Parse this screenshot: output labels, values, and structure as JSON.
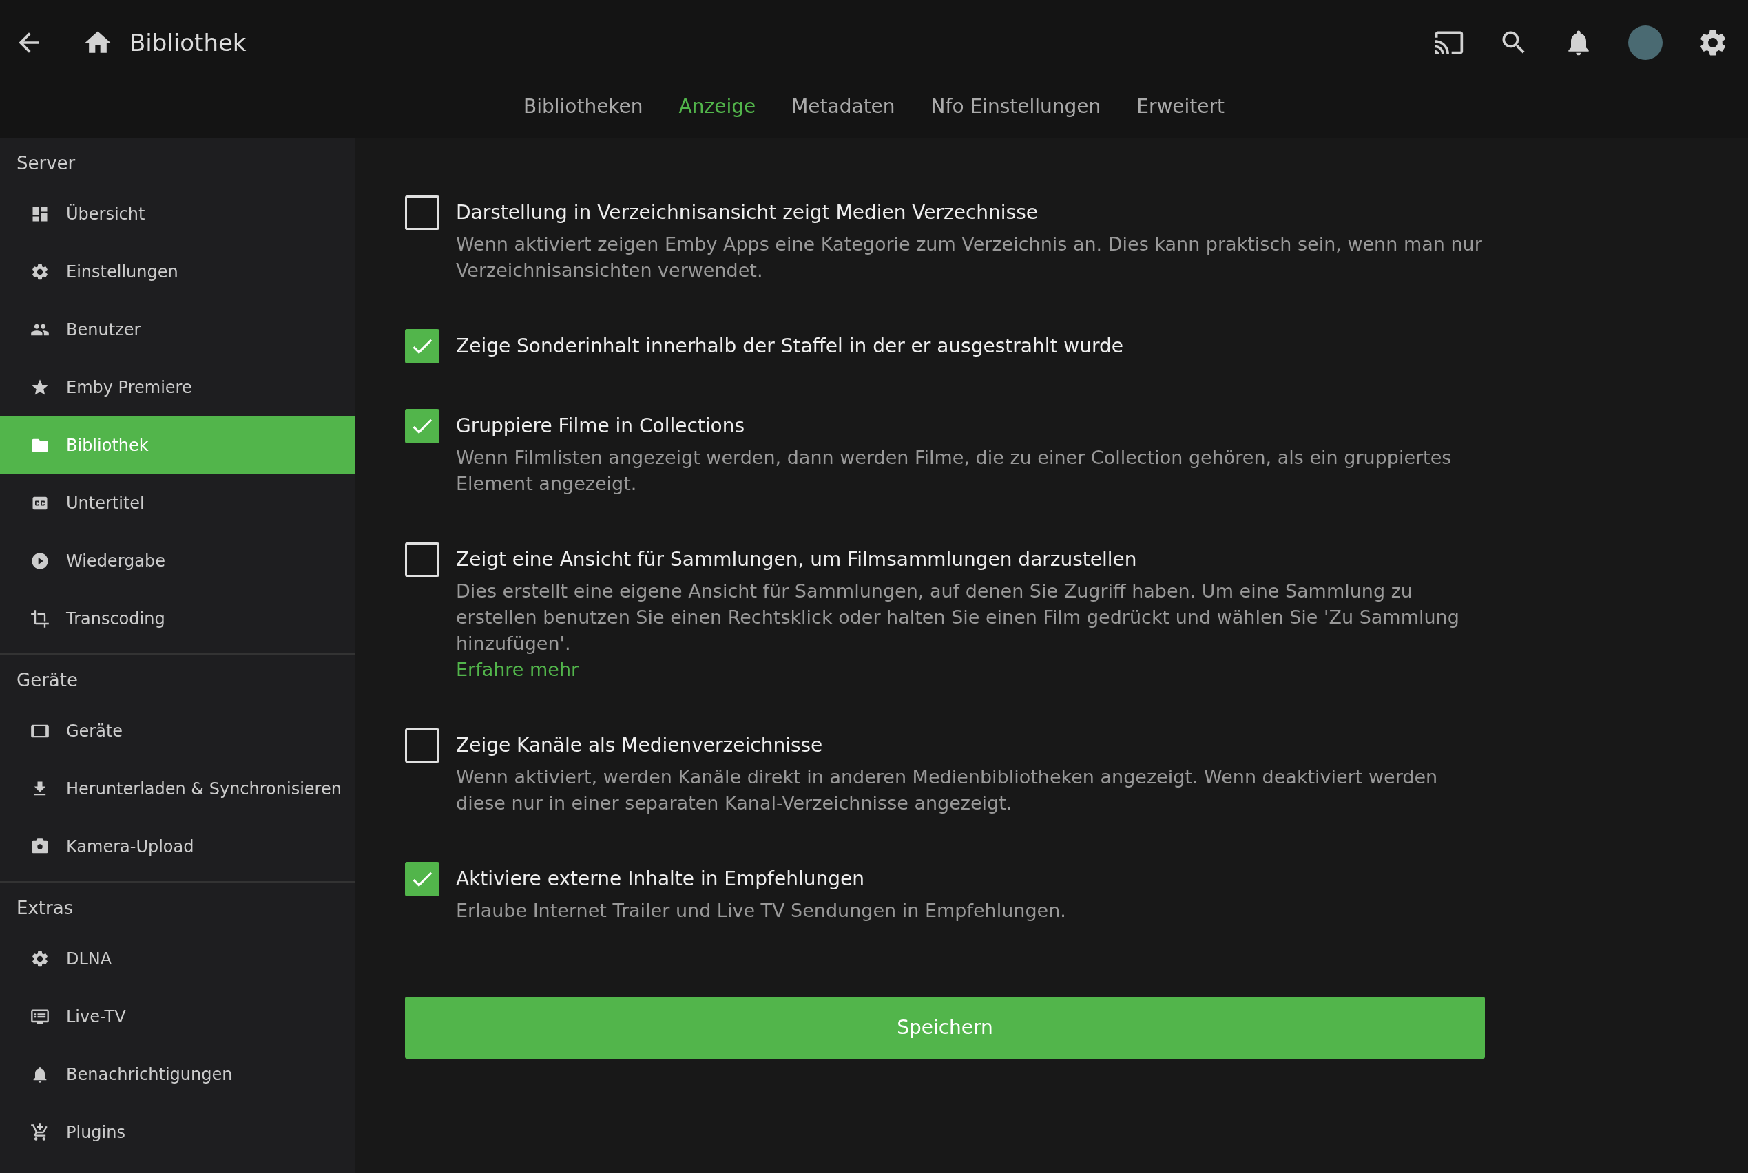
{
  "header": {
    "title": "Bibliothek",
    "tabs": [
      {
        "label": "Bibliotheken",
        "selected": false
      },
      {
        "label": "Anzeige",
        "selected": true
      },
      {
        "label": "Metadaten",
        "selected": false
      },
      {
        "label": "Nfo Einstellungen",
        "selected": false
      },
      {
        "label": "Erweitert",
        "selected": false
      }
    ]
  },
  "sidebar": {
    "sections": [
      {
        "heading": "Server",
        "items": [
          {
            "label": "Übersicht",
            "selected": false
          },
          {
            "label": "Einstellungen",
            "selected": false
          },
          {
            "label": "Benutzer",
            "selected": false
          },
          {
            "label": "Emby Premiere",
            "selected": false
          },
          {
            "label": "Bibliothek",
            "selected": true
          },
          {
            "label": "Untertitel",
            "selected": false
          },
          {
            "label": "Wiedergabe",
            "selected": false
          },
          {
            "label": "Transcoding",
            "selected": false
          }
        ]
      },
      {
        "heading": "Geräte",
        "items": [
          {
            "label": "Geräte",
            "selected": false
          },
          {
            "label": "Herunterladen & Synchronisieren",
            "selected": false
          },
          {
            "label": "Kamera-Upload",
            "selected": false
          }
        ]
      },
      {
        "heading": "Extras",
        "items": [
          {
            "label": "DLNA",
            "selected": false
          },
          {
            "label": "Live-TV",
            "selected": false
          },
          {
            "label": "Benachrichtigungen",
            "selected": false
          },
          {
            "label": "Plugins",
            "selected": false
          }
        ]
      }
    ]
  },
  "settings": [
    {
      "label": "Darstellung in Verzeichnisansicht zeigt Medien Verzechnisse",
      "checked": false,
      "description": "Wenn aktiviert zeigen Emby Apps eine Kategorie zum Verzeichnis an. Dies kann praktisch sein, wenn man nur Verzeichnisansichten verwendet."
    },
    {
      "label": "Zeige Sonderinhalt innerhalb der Staffel in der er ausgestrahlt wurde",
      "checked": true
    },
    {
      "label": "Gruppiere Filme in Collections",
      "checked": true,
      "description": "Wenn Filmlisten angezeigt werden, dann werden Filme, die zu einer Collection gehören, als ein gruppiertes Element angezeigt."
    },
    {
      "label": "Zeigt eine Ansicht für Sammlungen, um Filmsammlungen darzustellen",
      "checked": false,
      "description": "Dies erstellt eine eigene Ansicht für Sammlungen, auf denen Sie Zugriff haben. Um eine Sammlung zu erstellen benutzen Sie einen Rechtsklick oder halten Sie einen Film gedrückt und wählen Sie 'Zu Sammlung hinzufügen'.",
      "link": "Erfahre mehr"
    },
    {
      "label": "Zeige Kanäle als Medienverzeichnisse",
      "checked": false,
      "description": "Wenn aktiviert, werden Kanäle direkt in anderen Medienbibliotheken angezeigt. Wenn deaktiviert werden diese nur in einer separaten Kanal-Verzeichnisse angezeigt."
    },
    {
      "label": "Aktiviere externe Inhalte in Empfehlungen",
      "checked": true,
      "description": "Erlaube Internet Trailer und Live TV Sendungen in Empfehlungen."
    }
  ],
  "save_button": "Speichern"
}
